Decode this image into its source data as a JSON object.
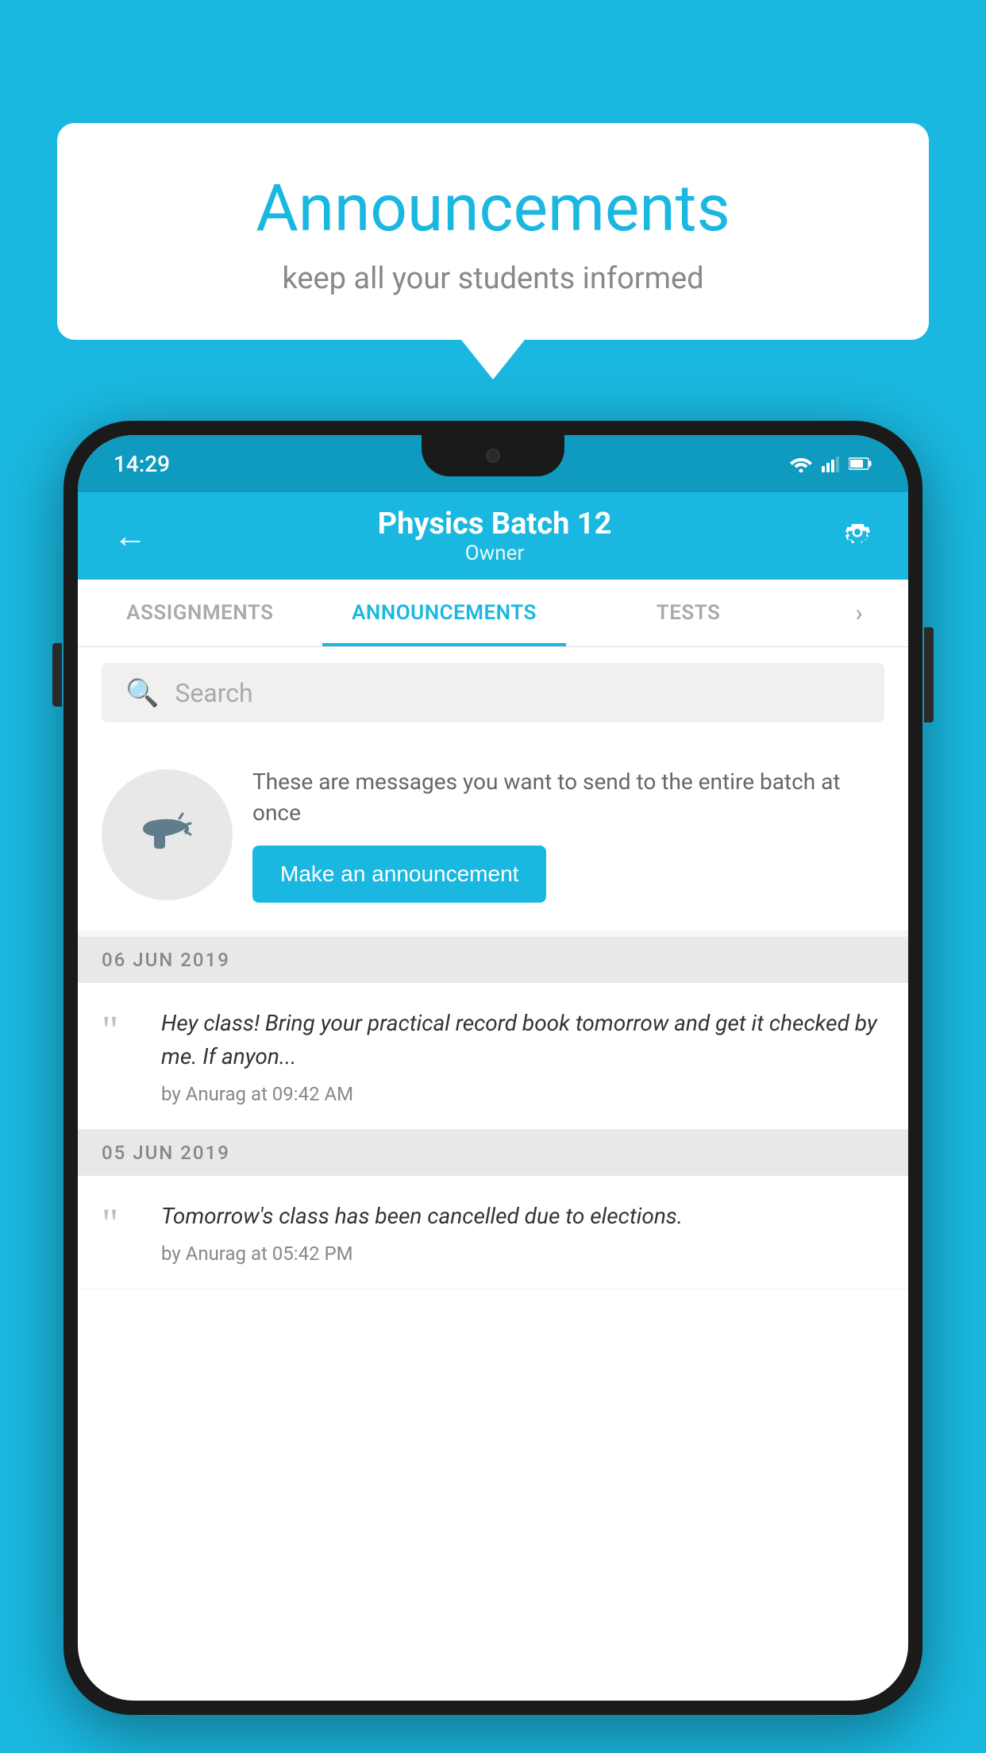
{
  "background_color": "#1ab8e0",
  "speech_bubble": {
    "title": "Announcements",
    "subtitle": "keep all your students informed"
  },
  "phone": {
    "status_bar": {
      "time": "14:29"
    },
    "app_bar": {
      "title": "Physics Batch 12",
      "subtitle": "Owner",
      "back_label": "←",
      "settings_label": "⚙"
    },
    "tabs": [
      {
        "label": "ASSIGNMENTS",
        "active": false
      },
      {
        "label": "ANNOUNCEMENTS",
        "active": true
      },
      {
        "label": "TESTS",
        "active": false
      }
    ],
    "search": {
      "placeholder": "Search"
    },
    "promo": {
      "text": "These are messages you want to send to the entire batch at once",
      "button_label": "Make an announcement"
    },
    "announcements": [
      {
        "date": "06  JUN  2019",
        "items": [
          {
            "text": "Hey class! Bring your practical record book tomorrow and get it checked by me. If anyon...",
            "meta": "by Anurag at 09:42 AM"
          }
        ]
      },
      {
        "date": "05  JUN  2019",
        "items": [
          {
            "text": "Tomorrow's class has been cancelled due to elections.",
            "meta": "by Anurag at 05:42 PM"
          }
        ]
      }
    ]
  }
}
